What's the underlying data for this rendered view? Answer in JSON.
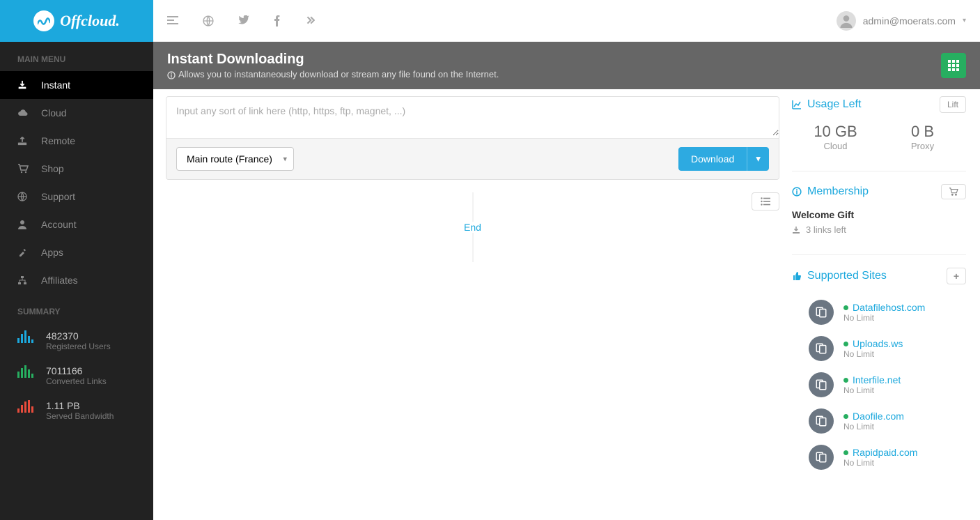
{
  "app": {
    "name": "Offcloud."
  },
  "topbar": {
    "user_email": "admin@moerats.com"
  },
  "sidebar": {
    "section_main": "MAIN MENU",
    "items": [
      {
        "label": "Instant",
        "icon": "download"
      },
      {
        "label": "Cloud",
        "icon": "cloud"
      },
      {
        "label": "Remote",
        "icon": "upload"
      },
      {
        "label": "Shop",
        "icon": "cart"
      },
      {
        "label": "Support",
        "icon": "globe"
      },
      {
        "label": "Account",
        "icon": "user"
      },
      {
        "label": "Apps",
        "icon": "tools"
      },
      {
        "label": "Affiliates",
        "icon": "sitemap"
      }
    ],
    "section_summary": "SUMMARY",
    "summary": [
      {
        "value": "482370",
        "label": "Registered Users",
        "color": "#1ca8dd"
      },
      {
        "value": "7011166",
        "label": "Converted Links",
        "color": "#27ae60"
      },
      {
        "value": "1.11 PB",
        "label": "Served Bandwidth",
        "color": "#e74c3c"
      }
    ]
  },
  "header": {
    "title": "Instant Downloading",
    "subtitle": "Allows you to instantaneously download or stream any file found on the Internet."
  },
  "download": {
    "placeholder": "Input any sort of link here (http, https, ftp, magnet, ...)",
    "route": "Main route (France)",
    "button": "Download"
  },
  "timeline": {
    "end": "End"
  },
  "usage": {
    "title": "Usage Left",
    "lift": "Lift",
    "cloud_value": "10 GB",
    "cloud_label": "Cloud",
    "proxy_value": "0 B",
    "proxy_label": "Proxy"
  },
  "membership": {
    "title": "Membership",
    "gift": "Welcome Gift",
    "links_left": "3 links left"
  },
  "supported": {
    "title": "Supported Sites",
    "limit": "No Limit",
    "sites": [
      {
        "name": "Datafilehost.com"
      },
      {
        "name": "Uploads.ws"
      },
      {
        "name": "Interfile.net"
      },
      {
        "name": "Daofile.com"
      },
      {
        "name": "Rapidpaid.com"
      }
    ]
  }
}
